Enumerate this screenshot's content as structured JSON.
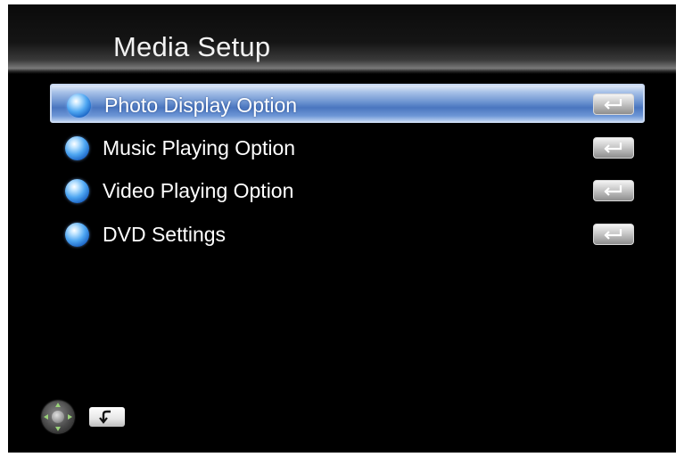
{
  "header": {
    "title": "Media Setup"
  },
  "menu": {
    "items": [
      {
        "label": "Photo Display Option",
        "selected": true,
        "icon": "blue-orb-icon",
        "action_icon": "enter-key-icon"
      },
      {
        "label": "Music Playing Option",
        "selected": false,
        "icon": "blue-orb-icon",
        "action_icon": "enter-key-icon"
      },
      {
        "label": "Video Playing Option",
        "selected": false,
        "icon": "blue-orb-icon",
        "action_icon": "enter-key-icon"
      },
      {
        "label": "DVD Settings",
        "selected": false,
        "icon": "blue-orb-icon",
        "action_icon": "enter-key-icon"
      }
    ]
  },
  "footer": {
    "navigate_icon": "dpad-icon",
    "back_icon": "back-key-icon"
  },
  "colors": {
    "background": "#000000",
    "selection": "#4a76bf",
    "text": "#ffffff"
  }
}
